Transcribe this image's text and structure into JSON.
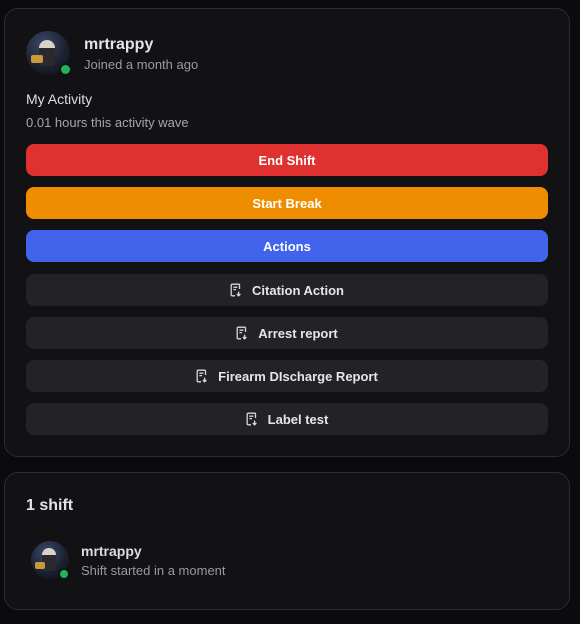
{
  "profile": {
    "username": "mrtrappy",
    "joined": "Joined a month ago",
    "online": true
  },
  "activity": {
    "title": "My Activity",
    "hours": "0.01 hours this activity wave"
  },
  "actions": {
    "end_shift": "End Shift",
    "start_break": "Start Break",
    "actions": "Actions",
    "forms": [
      {
        "label": "Citation Action",
        "icon": "form-icon"
      },
      {
        "label": "Arrest report",
        "icon": "form-icon"
      },
      {
        "label": "Firearm DIscharge Report",
        "icon": "form-icon"
      },
      {
        "label": "Label test",
        "icon": "form-icon"
      }
    ]
  },
  "shifts": {
    "count_label": "1 shift",
    "items": [
      {
        "username": "mrtrappy",
        "status": "Shift started in a moment"
      }
    ]
  },
  "colors": {
    "end_shift": "#e03131",
    "start_break": "#ef8d00",
    "actions": "#4263eb",
    "online": "#22b35a"
  }
}
